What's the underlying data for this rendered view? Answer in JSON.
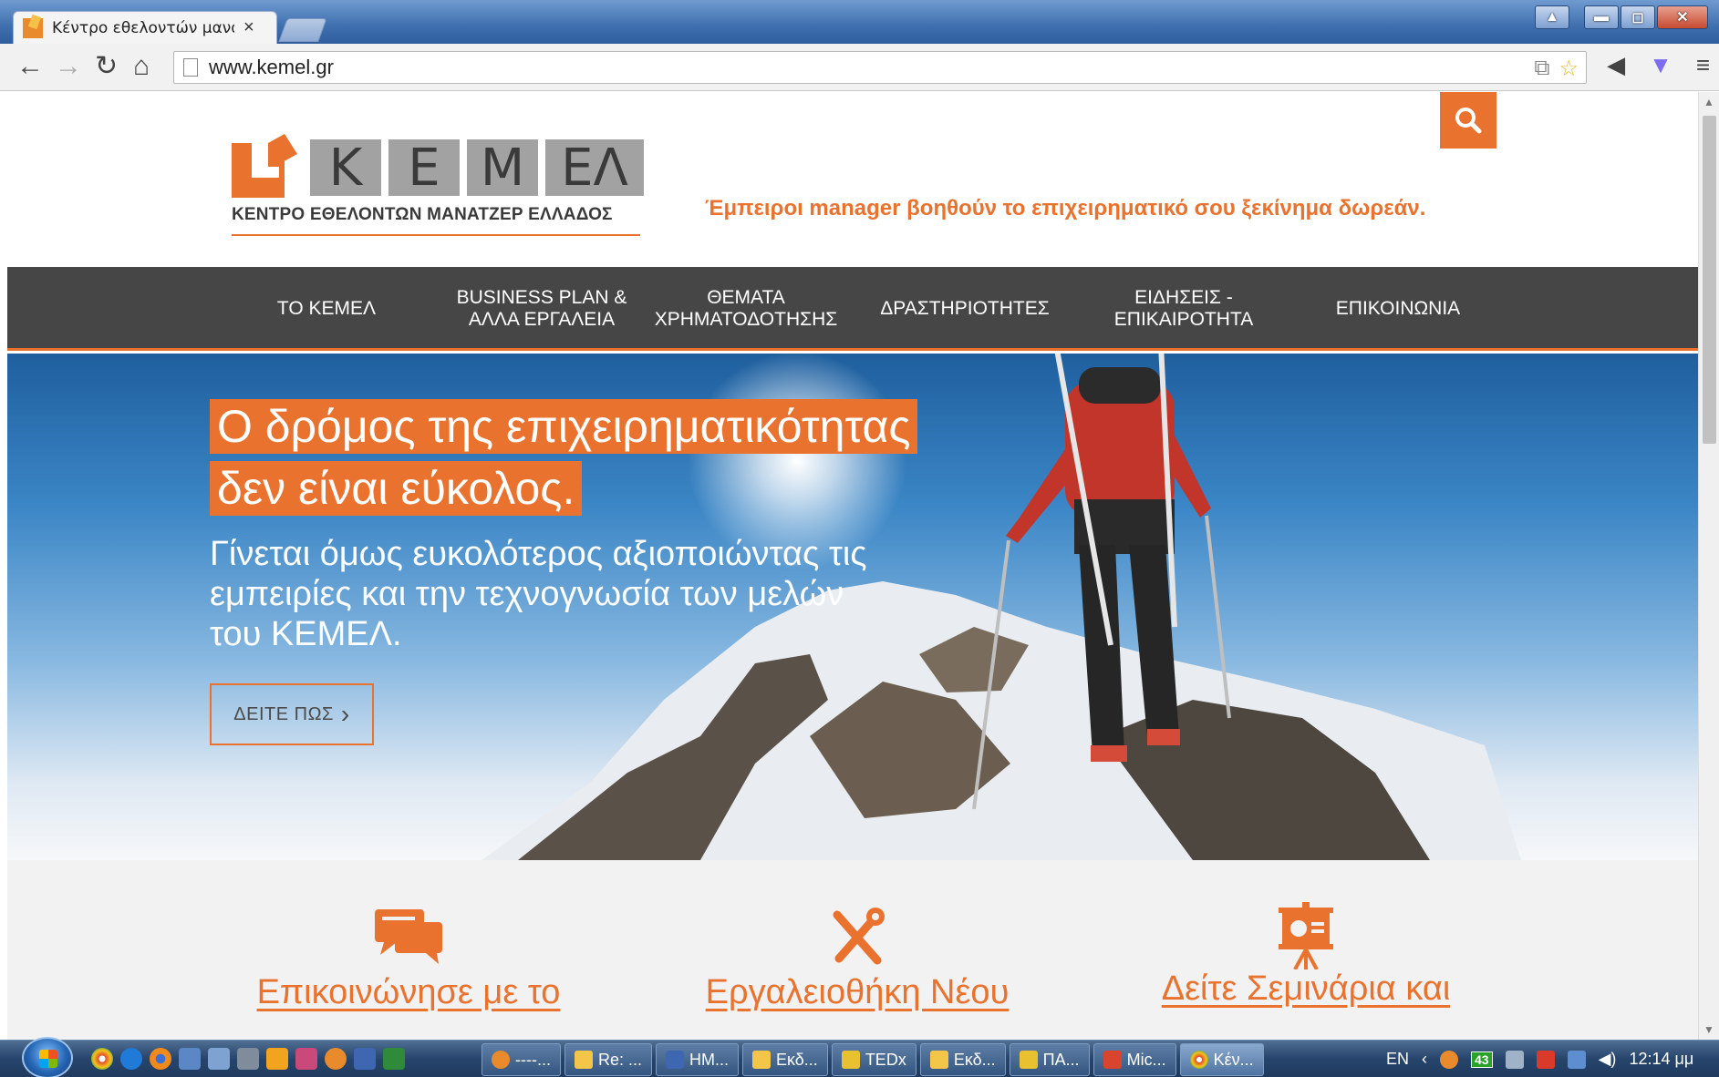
{
  "browser": {
    "tab_title": "Κέντρο εθελοντών μανατ",
    "tab_close": "×",
    "url": "www.kemel.gr",
    "window_buttons": {
      "user": "▲",
      "minimize": "▬",
      "maximize": "◻",
      "close": "✕"
    }
  },
  "site": {
    "logo": {
      "letters": [
        "Κ",
        "Ε",
        "Μ",
        "ΕΛ"
      ],
      "subtitle": "ΚΕΝΤΡΟ ΕΘΕΛΟΝΤΩΝ ΜΑΝΑΤΖΕΡ ΕΛΛΑΔΟΣ"
    },
    "tagline": "Έμπειροι manager βοηθούν το επιχειρηματικό σου ξεκίνημα δωρεάν.",
    "menu": [
      {
        "label": "ΤΟ ΚΕΜΕΛ"
      },
      {
        "label": "BUSINESS PLAN & ΑΛΛΑ ΕΡΓΑΛΕΙΑ"
      },
      {
        "label": "ΘΕΜΑΤΑ ΧΡΗΜΑΤΟΔΟΤΗΣΗΣ"
      },
      {
        "label": "ΔΡΑΣΤΗΡΙΟΤΗΤΕΣ"
      },
      {
        "label": "ΕΙΔΗΣΕΙΣ - ΕΠΙΚΑΙΡΟΤΗΤΑ"
      },
      {
        "label": "ΕΠΙΚΟΙΝΩΝΙΑ"
      }
    ],
    "hero": {
      "headline_line1": "Ο δρόμος της επιχειρηματικότητας",
      "headline_line2": "δεν είναι εύκολος.",
      "subtext": "Γίνεται όμως ευκολότερος αξιοποιώντας τις εμπειρίες και την τεχνογνωσία των μελών του ΚΕΜΕΛ.",
      "button_label": "ΔΕΙΤΕ ΠΩΣ",
      "button_chevron": "›"
    },
    "features": [
      {
        "label": "Επικοινώνησε με το",
        "icon": "chat-bubbles-icon"
      },
      {
        "label": "Εργαλειοθήκη Νέου",
        "icon": "tools-icon"
      },
      {
        "label": "Δείτε Σεμινάρια και",
        "icon": "presentation-icon"
      }
    ]
  },
  "taskbar": {
    "tasks": [
      {
        "label": "----..."
      },
      {
        "label": "Re: ..."
      },
      {
        "label": "HM..."
      },
      {
        "label": "Εκδ..."
      },
      {
        "label": "TEDx"
      },
      {
        "label": "Εκδ..."
      },
      {
        "label": "ΠΑ..."
      },
      {
        "label": "Mic..."
      },
      {
        "label": "Κέν..."
      }
    ],
    "language": "EN",
    "tray_arrow": "‹",
    "badge_count": "43",
    "clock": "12:14 μμ"
  },
  "colors": {
    "accent": "#e8722e",
    "menu_bg": "#464646",
    "logo_gray": "#a2a2a2"
  }
}
